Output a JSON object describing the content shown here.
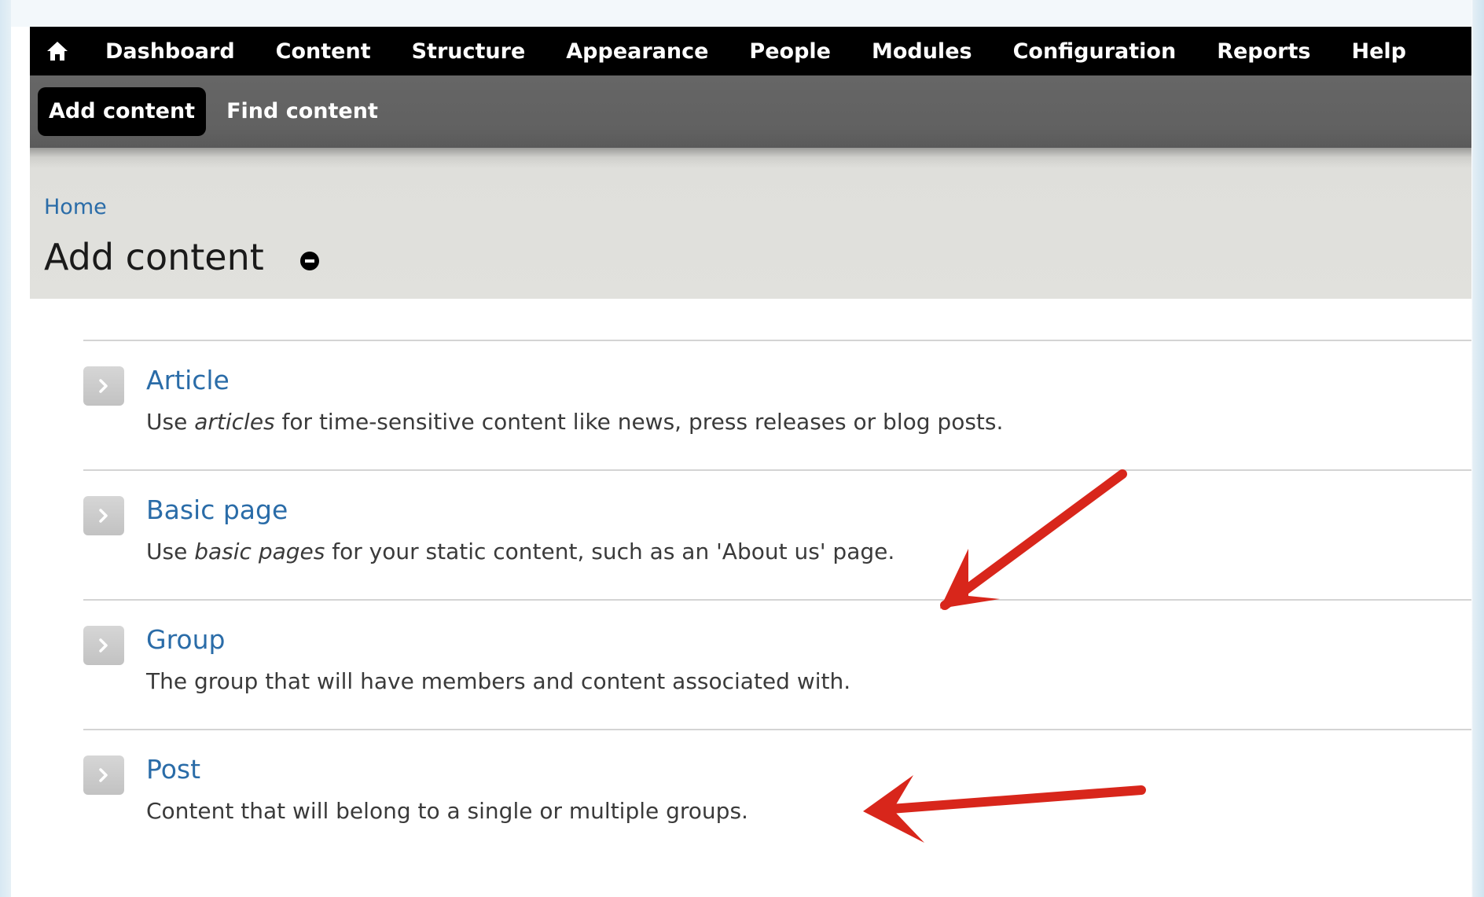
{
  "toolbar": {
    "home_icon": "home-icon",
    "items": [
      {
        "label": "Dashboard"
      },
      {
        "label": "Content"
      },
      {
        "label": "Structure"
      },
      {
        "label": "Appearance"
      },
      {
        "label": "People"
      },
      {
        "label": "Modules"
      },
      {
        "label": "Configuration"
      },
      {
        "label": "Reports"
      },
      {
        "label": "Help"
      }
    ]
  },
  "shortcuts": {
    "items": [
      {
        "label": "Add content",
        "active": true
      },
      {
        "label": "Find content",
        "active": false
      }
    ]
  },
  "header": {
    "breadcrumb": "Home",
    "title": "Add content",
    "shortcut_toggle_icon": "minus-circle-icon"
  },
  "content_types": [
    {
      "name": "Article",
      "description": {
        "before": "Use ",
        "em": "articles",
        "after": " for time-sensitive content like news, press releases or blog posts."
      }
    },
    {
      "name": "Basic page",
      "description": {
        "before": "Use ",
        "em": "basic pages",
        "after": " for your static content, such as an 'About us' page."
      }
    },
    {
      "name": "Group",
      "description": {
        "before": "The group that will have members and content associated with.",
        "em": "",
        "after": ""
      }
    },
    {
      "name": "Post",
      "description": {
        "before": "Content that will belong to a single or multiple groups.",
        "em": "",
        "after": ""
      }
    }
  ],
  "colors": {
    "toolbar_bg": "#000000",
    "shortcuts_bg": "#666666",
    "header_bg": "#e1e1dd",
    "link": "#2a6ca8",
    "annotation_arrow": "#d8261b"
  }
}
